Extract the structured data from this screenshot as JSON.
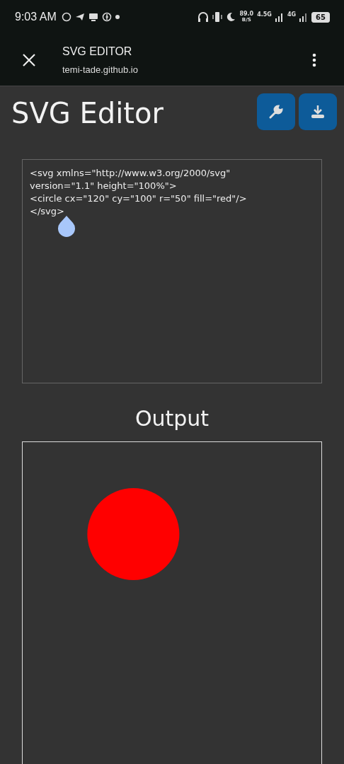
{
  "status_bar": {
    "time": "9:03 AM",
    "net_speed": "89.0",
    "net_unit": "B/S",
    "network_1": "4.5G",
    "network_2": "4G",
    "battery": "65"
  },
  "browser_bar": {
    "title": "SVG EDITOR",
    "url": "temi-tade.github.io"
  },
  "page": {
    "title": "SVG Editor",
    "code": "<svg xmlns=\"http://www.w3.org/2000/svg\"\nversion=\"1.1\" height=\"100%\">\n<circle cx=\"120\" cy=\"100\" r=\"50\" fill=\"red\"/>\n</svg>",
    "output_heading": "Output"
  }
}
